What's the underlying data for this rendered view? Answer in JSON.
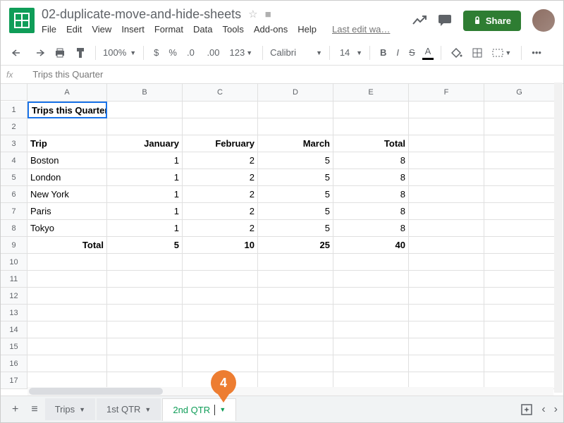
{
  "doc": {
    "title": "02-duplicate-move-and-hide-sheets"
  },
  "menus": [
    "File",
    "Edit",
    "View",
    "Insert",
    "Format",
    "Data",
    "Tools",
    "Add-ons",
    "Help"
  ],
  "last_edit": "Last edit wa…",
  "share": "Share",
  "toolbar": {
    "zoom": "100%",
    "formats": "123",
    "font": "Calibri",
    "size": "14"
  },
  "formula": "Trips this Quarter",
  "cols": [
    "A",
    "B",
    "C",
    "D",
    "E",
    "F",
    "G"
  ],
  "a1": "Trips this Quarter",
  "headers": {
    "trip": "Trip",
    "jan": "January",
    "feb": "February",
    "mar": "March",
    "total": "Total"
  },
  "rows": [
    {
      "trip": "Boston",
      "jan": "1",
      "feb": "2",
      "mar": "5",
      "total": "8"
    },
    {
      "trip": "London",
      "jan": "1",
      "feb": "2",
      "mar": "5",
      "total": "8"
    },
    {
      "trip": "New York",
      "jan": "1",
      "feb": "2",
      "mar": "5",
      "total": "8"
    },
    {
      "trip": "Paris",
      "jan": "1",
      "feb": "2",
      "mar": "5",
      "total": "8"
    },
    {
      "trip": "Tokyo",
      "jan": "1",
      "feb": "2",
      "mar": "5",
      "total": "8"
    }
  ],
  "totals": {
    "label": "Total",
    "jan": "5",
    "feb": "10",
    "mar": "25",
    "total": "40"
  },
  "tabs": {
    "t1": "Trips",
    "t2": "1st QTR",
    "t3": "2nd QTR"
  },
  "callout": "4"
}
